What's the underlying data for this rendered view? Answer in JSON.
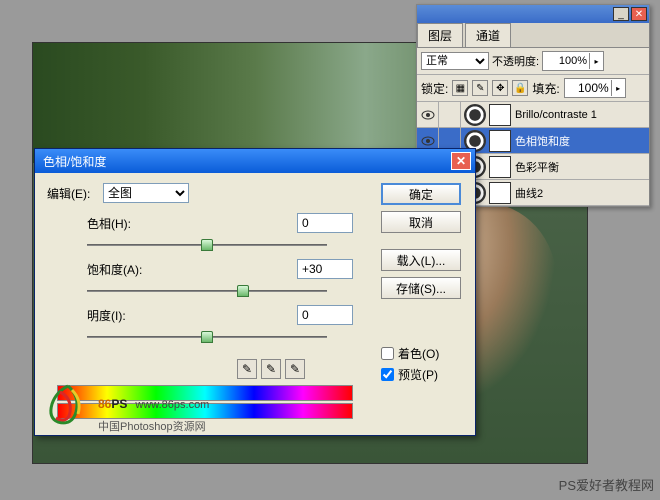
{
  "layers_panel": {
    "tabs": [
      "图层",
      "通道"
    ],
    "blend_mode": "正常",
    "opacity_label": "不透明度:",
    "opacity_value": "100%",
    "lock_label": "锁定:",
    "fill_label": "填充:",
    "fill_value": "100%",
    "layers": [
      {
        "name": "Brillo/contraste 1",
        "selected": false
      },
      {
        "name": "色相饱和度",
        "selected": true
      },
      {
        "name": "色彩平衡",
        "selected": false
      },
      {
        "name": "曲线2",
        "selected": false
      }
    ]
  },
  "dialog": {
    "title": "色相/饱和度",
    "edit_label": "编辑(E):",
    "edit_value": "全图",
    "sliders": {
      "hue_label": "色相(H):",
      "hue_value": "0",
      "sat_label": "饱和度(A):",
      "sat_value": "+30",
      "light_label": "明度(I):",
      "light_value": "0"
    },
    "buttons": {
      "ok": "确定",
      "cancel": "取消",
      "load": "载入(L)...",
      "save": "存储(S)..."
    },
    "colorize_label": "着色(O)",
    "preview_label": "预览(P)"
  },
  "watermark": {
    "brand": "86",
    "suffix": "PS",
    "url": "www.86ps.com",
    "subtitle": "中国Photoshop资源网"
  },
  "credit": "PS爱好者教程网"
}
